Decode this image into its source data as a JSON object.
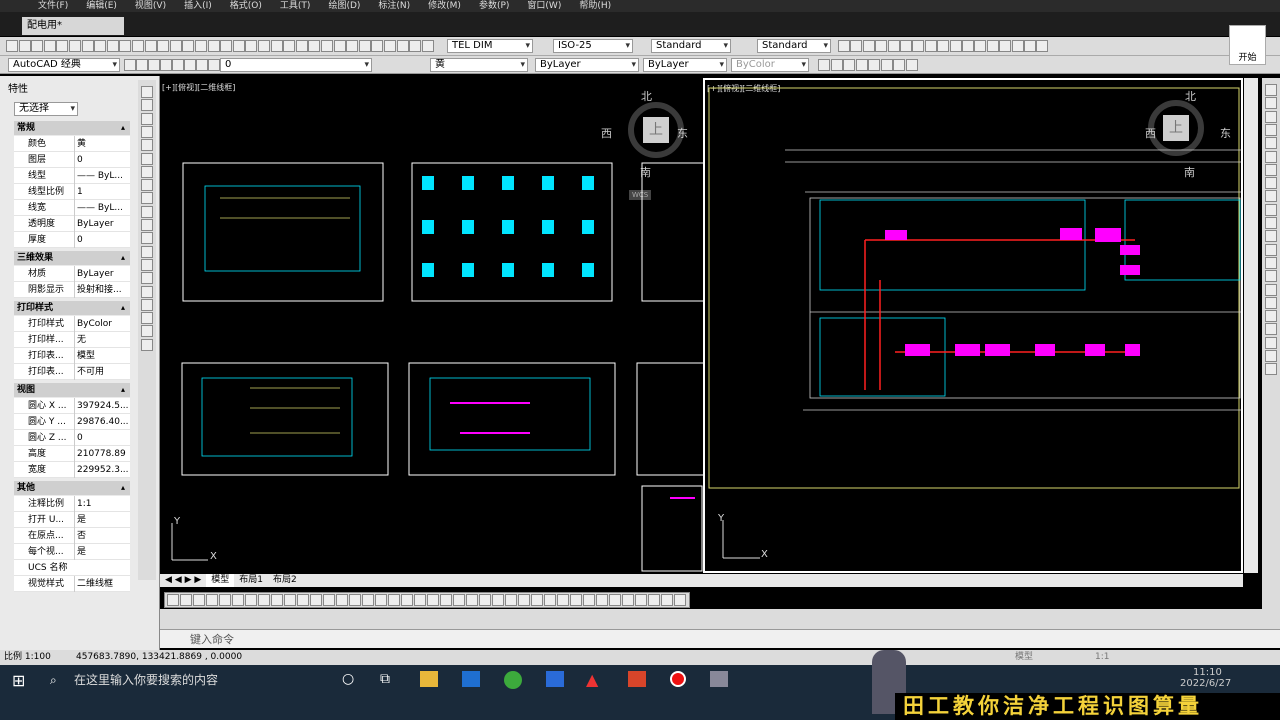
{
  "menu": [
    "文件(F)",
    "编辑(E)",
    "视图(V)",
    "插入(I)",
    "格式(O)",
    "工具(T)",
    "绘图(D)",
    "标注(N)",
    "修改(M)",
    "参数(P)",
    "窗口(W)",
    "帮助(H)"
  ],
  "file_tab": "配电用*",
  "toolbar": {
    "text_style": "TEL DIM",
    "dim_style": "ISO-25",
    "table_style": "Standard",
    "mleader_style": "Standard",
    "workspace": "AutoCAD 经典",
    "layer": "0",
    "color": "黄",
    "linetype": "ByLayer",
    "lineweight": "ByLayer",
    "plotstyle": "ByColor"
  },
  "properties": {
    "title": "特性",
    "selection": "无选择",
    "sections": [
      {
        "name": "常规",
        "rows": [
          [
            "颜色",
            "黄"
          ],
          [
            "图层",
            "0"
          ],
          [
            "线型",
            "—— ByL..."
          ],
          [
            "线型比例",
            "1"
          ],
          [
            "线宽",
            "—— ByL..."
          ],
          [
            "透明度",
            "ByLayer"
          ],
          [
            "厚度",
            "0"
          ]
        ]
      },
      {
        "name": "三维效果",
        "rows": [
          [
            "材质",
            "ByLayer"
          ],
          [
            "阴影显示",
            "投射和接..."
          ]
        ]
      },
      {
        "name": "打印样式",
        "rows": [
          [
            "打印样式",
            "ByColor"
          ],
          [
            "打印样...",
            "无"
          ],
          [
            "打印表...",
            "模型"
          ],
          [
            "打印表...",
            "不可用"
          ]
        ]
      },
      {
        "name": "视图",
        "rows": [
          [
            "圆心 X ...",
            "397924.5..."
          ],
          [
            "圆心 Y ...",
            "29876.40..."
          ],
          [
            "圆心 Z ...",
            "0"
          ],
          [
            "高度",
            "210778.89"
          ],
          [
            "宽度",
            "229952.3..."
          ]
        ]
      },
      {
        "name": "其他",
        "rows": [
          [
            "注释比例",
            "1:1"
          ],
          [
            "打开 U...",
            "是"
          ],
          [
            "在原点...",
            "否"
          ],
          [
            "每个视...",
            "是"
          ],
          [
            "UCS 名称",
            ""
          ],
          [
            "视觉样式",
            "二维线框"
          ]
        ]
      }
    ]
  },
  "viewport_left_label": "[+][俯视][二维线框]",
  "viewport_right_label": "[+][俯视][二维线框]",
  "compass": {
    "north": "北",
    "south": "南",
    "east": "东",
    "west": "西",
    "top": "上",
    "wcs": "WCS"
  },
  "layout_tabs": [
    "模型",
    "布局1",
    "布局2"
  ],
  "command_prompt": "键入命令",
  "status": {
    "scale": "比例 1:100",
    "coords": "457683.7890, 133421.8869 , 0.0000",
    "mode": "模型",
    "ratio": "1:1"
  },
  "taskbar": {
    "search": "在这里输入你要搜索的内容",
    "time": "11:10",
    "date": "2022/6/27"
  },
  "banner": "田工教你洁净工程识图算量",
  "corner_button": "开始",
  "colors": {
    "accent": "#ff00ff",
    "red": "#ff2020",
    "yellow": "#d6d66b",
    "cyan": "#00e5ff"
  }
}
